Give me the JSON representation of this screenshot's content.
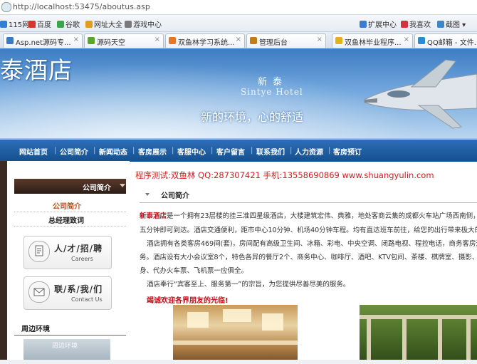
{
  "browser": {
    "address": "http://localhost:53475/aboutus.asp",
    "favorites": [
      {
        "label": "115网盘",
        "color": "#2f7fd8"
      },
      {
        "label": "百度",
        "color": "#d8342f"
      },
      {
        "label": "谷歌",
        "color": "#3aa64c"
      },
      {
        "label": "网址大全",
        "color": "#e59a1c"
      },
      {
        "label": "游戏中心",
        "color": "#7a7a7a"
      }
    ],
    "right_favorites": [
      {
        "label": "扩展中心",
        "color": "#3b7bd4"
      },
      {
        "label": "我喜欢",
        "color": "#d6333b"
      },
      {
        "label": "截图",
        "color": "#3a88c9"
      }
    ],
    "tabs": [
      {
        "label": "Asp.net源码专...",
        "color": "#3b79c3"
      },
      {
        "label": "源码天空",
        "color": "#5aa52b"
      },
      {
        "label": "双鱼林学习系统...",
        "color": "#e6761f"
      },
      {
        "label": "管理后台",
        "color": "#c27c1c"
      },
      {
        "label": "双鱼林毕业程序...",
        "color": "#e2b11d"
      },
      {
        "label": "QQ邮箱 - 文件...",
        "color": "#2d8ad6"
      }
    ]
  },
  "banner": {
    "logo": "泰酒店",
    "name_cn": "新泰",
    "name_en": "Sintye Hotel",
    "slogan": "新的环境，心的舒适"
  },
  "nav": [
    "网站首页",
    "公司简介",
    "新闻动态",
    "客房展示",
    "客服中心",
    "客户留言",
    "联系我们",
    "人力资源",
    "客房预订"
  ],
  "sidebar": {
    "header": "公司简介",
    "menu": [
      "公司简介",
      "总经理致词"
    ],
    "recruit": {
      "cn": "人/才/招/聘",
      "en": "Careers"
    },
    "contact": {
      "cn": "联/系/我/们",
      "en": "Contact Us"
    },
    "env_title": "周边环境",
    "env_caption": "周边环境"
  },
  "main": {
    "promo": "程序测试:双鱼林 QQ:287307421 手机:13558690869 www.shuangyulin.com",
    "section_title": "公司简介",
    "para1_highlight": "新泰酒店",
    "para1_rest": "是一个拥有23层楼的挂三准四星级酒店，大楼建筑宏伟、典雅，地处客商云集的成都火车站广场西南侧，距",
    "para1_line2": "五分钟即可到达。酒店交通便利，距市中心10分钟、机场40分钟车程。均有直达班车前往，给您的出行带来极大的方便",
    "para2_line1": "酒店拥有各类客房469间(套)，房间配有高级卫生间、冰箱、彩电、中央空调、闭路电视、程控电话，商务客房还可提",
    "para2_line2": "务。酒店设有大小会议室8个，特色各异的餐厅2个、商务中心、咖啡厅、酒吧、KTV包间、茶楼、棋牌室、摄影、美容美",
    "para2_line3": "身、代办火车票、飞机票一应俱全。",
    "para3": "酒店奉行“宾客至上、服务第一”的宗旨，为您提供尽善尽美的服务。",
    "welcome": "竭诚欢迎各界朋友的光临!"
  }
}
